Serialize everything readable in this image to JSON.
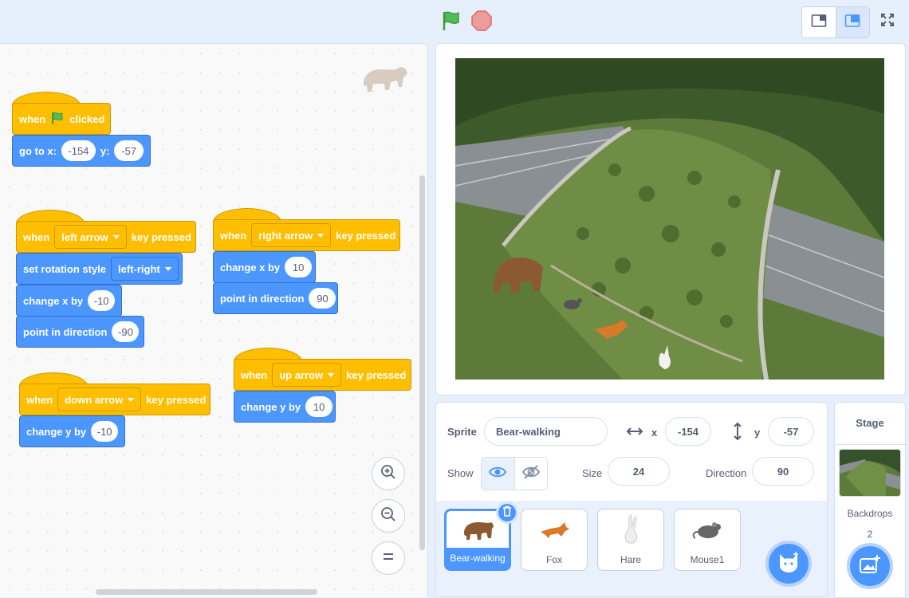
{
  "toolbar": {
    "flag_icon": "green-flag-icon",
    "stop_icon": "stop-icon",
    "colors": {
      "flag": "#4cbf56",
      "stop": "#ec9c9c"
    }
  },
  "code": {
    "green_flag_script": {
      "hat": {
        "word1": "when",
        "word2": "clicked"
      },
      "goto": {
        "label1": "go to x:",
        "x": "-154",
        "label2": "y:",
        "y": "-57"
      }
    },
    "left_script": {
      "hat": {
        "word": "when",
        "key": "left arrow",
        "tail": "key pressed"
      },
      "rotation": {
        "label": "set rotation style",
        "value": "left-right"
      },
      "changex": {
        "label": "change x by",
        "value": "-10"
      },
      "direction": {
        "label": "point in direction",
        "value": "-90"
      }
    },
    "right_script": {
      "hat": {
        "word": "when",
        "key": "right arrow",
        "tail": "key pressed"
      },
      "changex": {
        "label": "change x by",
        "value": "10"
      },
      "direction": {
        "label": "point in direction",
        "value": "90"
      }
    },
    "down_script": {
      "hat": {
        "word": "when",
        "key": "down arrow",
        "tail": "key pressed"
      },
      "changey": {
        "label": "change y by",
        "value": "-10"
      }
    },
    "up_script": {
      "hat": {
        "word": "when",
        "key": "up arrow",
        "tail": "key pressed"
      },
      "changey": {
        "label": "change y by",
        "value": "10"
      }
    },
    "colors": {
      "events": "#ffbf00",
      "motion": "#4c97ff"
    }
  },
  "sprite_info": {
    "sprite_label": "Sprite",
    "sprite_name": "Bear-walking",
    "x_label": "x",
    "x": "-154",
    "y_label": "y",
    "y": "-57",
    "show_label": "Show",
    "size_label": "Size",
    "size": "24",
    "direction_label": "Direction",
    "direction": "90"
  },
  "sprites": [
    {
      "name": "Bear-walking",
      "selected": true
    },
    {
      "name": "Fox"
    },
    {
      "name": "Hare"
    },
    {
      "name": "Mouse1"
    }
  ],
  "stage_panel": {
    "title": "Stage",
    "backdrops_label": "Backdrops",
    "backdrops_count": "2"
  }
}
